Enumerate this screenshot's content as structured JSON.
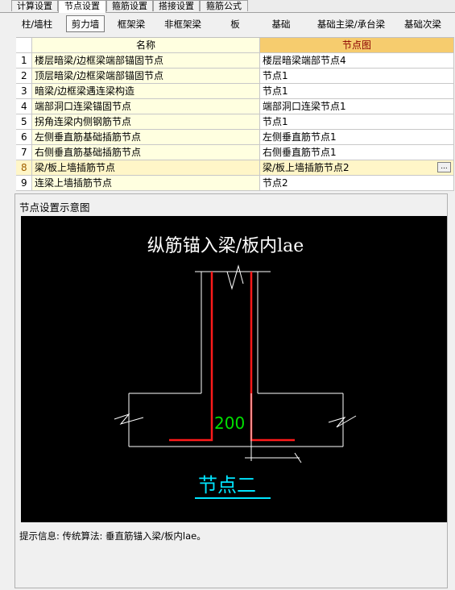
{
  "top_tabs": [
    "计算设置",
    "节点设置",
    "箍筋设置",
    "搭接设置",
    "箍筋公式"
  ],
  "sub_tabs": [
    "柱/墙柱",
    "剪力墙",
    "框架梁",
    "非框架梁",
    "板",
    "基础",
    "基础主梁/承台梁",
    "基础次梁"
  ],
  "table": {
    "headers": {
      "name": "名称",
      "node": "节点图"
    },
    "rows": [
      {
        "idx": "1",
        "name": "楼层暗梁/边框梁端部锚固节点",
        "node": "楼层暗梁端部节点4"
      },
      {
        "idx": "2",
        "name": "顶层暗梁/边框梁端部锚固节点",
        "node": "节点1"
      },
      {
        "idx": "3",
        "name": "暗梁/边框梁遇连梁构造",
        "node": "节点1"
      },
      {
        "idx": "4",
        "name": "端部洞口连梁锚固节点",
        "node": "端部洞口连梁节点1"
      },
      {
        "idx": "5",
        "name": "拐角连梁内侧钢筋节点",
        "node": "节点1"
      },
      {
        "idx": "6",
        "name": "左侧垂直筋基础插筋节点",
        "node": "左侧垂直筋节点1"
      },
      {
        "idx": "7",
        "name": "右侧垂直筋基础插筋节点",
        "node": "右侧垂直筋节点1"
      },
      {
        "idx": "8",
        "name": "梁/板上墙插筋节点",
        "node": "梁/板上墙插筋节点2"
      },
      {
        "idx": "9",
        "name": "连梁上墙插筋节点",
        "node": "节点2"
      }
    ],
    "ellipsis": "..."
  },
  "panel": {
    "title": "节点设置示意图",
    "diagram_title": "纵筋锚入梁/板内lae",
    "dimension": "200",
    "node_label": "节点二",
    "hint": "提示信息: 传统算法: 垂直筋锚入梁/板内lae。"
  },
  "colors": {
    "header_node_bg": "#f6cc6e",
    "name_col_bg": "#ffffe0",
    "rebar": "#ff0000",
    "dimension": "#00ff00",
    "node_label": "#00e5ff"
  }
}
